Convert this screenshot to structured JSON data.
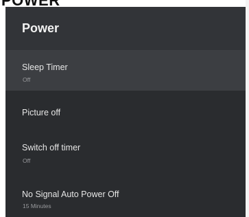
{
  "page": {
    "heading": "POWER"
  },
  "panel": {
    "title": "Power",
    "items": [
      {
        "label": "Sleep Timer",
        "value": "Off",
        "selected": true
      },
      {
        "label": "Picture off",
        "value": "",
        "selected": false
      },
      {
        "label": "Switch off timer",
        "value": "Off",
        "selected": false
      },
      {
        "label": "No Signal Auto Power Off",
        "value": "15 Minutes",
        "selected": false
      }
    ]
  },
  "colors": {
    "panel_background": "#2a2c2f",
    "header_background": "#323438",
    "selected_item_background": "#3c3e42",
    "label_text": "#e6e6e6",
    "value_text": "#9a9b9e"
  }
}
